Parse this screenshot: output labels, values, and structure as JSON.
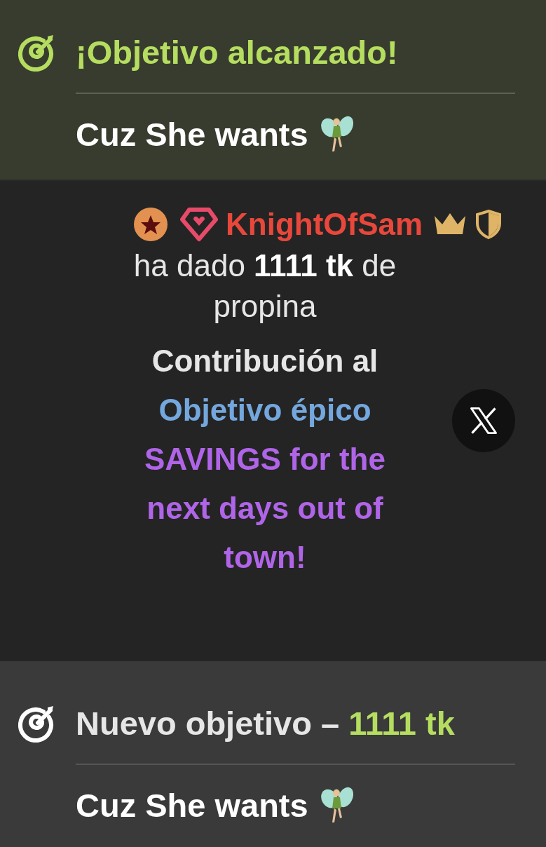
{
  "goal_reached": {
    "title": "¡Objetivo alcanzado!",
    "name": "Cuz She wants"
  },
  "tip": {
    "user": "KnightOfSam",
    "message": "ha dado **1111 tk** de propina",
    "contribution": [
      {
        "kind": "plain",
        "text": "Contribución al"
      },
      {
        "kind": "goal_type",
        "text": "Objetivo épico"
      },
      {
        "kind": "goal_name",
        "text": "SAVINGS for the next days out of town!"
      }
    ]
  },
  "new_goal": {
    "title": [
      {
        "kind": "plain",
        "text": "Nuevo objetivo –"
      },
      {
        "kind": "amount",
        "text": "1111 tk"
      }
    ],
    "name": "Cuz She wants"
  }
}
